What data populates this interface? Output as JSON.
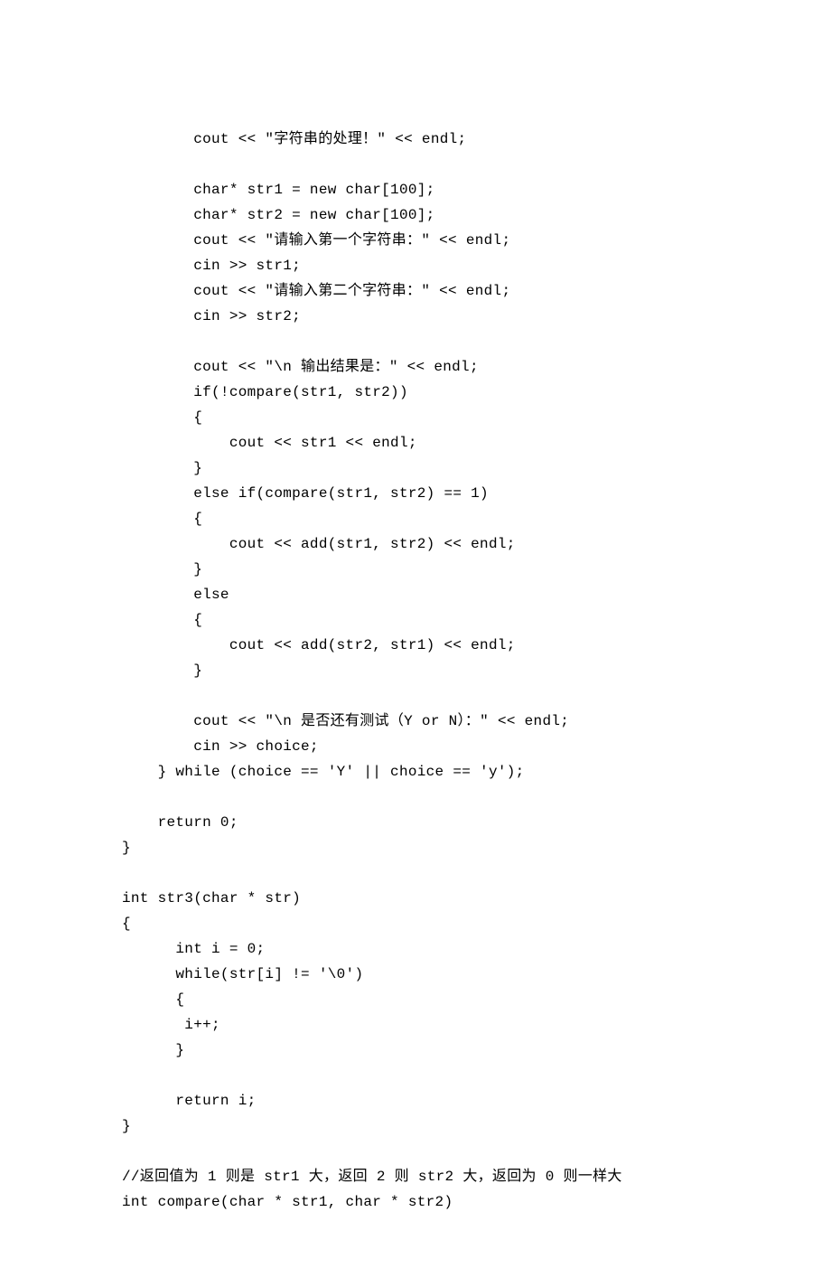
{
  "lines": [
    "        cout << \"字符串的处理！\" << endl;",
    "",
    "        char* str1 = new char[100];",
    "        char* str2 = new char[100];",
    "        cout << \"请输入第一个字符串：\" << endl;",
    "        cin >> str1;",
    "        cout << \"请输入第二个字符串：\" << endl;",
    "        cin >> str2;",
    "",
    "        cout << \"\\n 输出结果是：\" << endl;",
    "        if(!compare(str1, str2))",
    "        {",
    "            cout << str1 << endl;",
    "        }",
    "        else if(compare(str1, str2) == 1)",
    "        {",
    "            cout << add(str1, str2) << endl;",
    "        }",
    "        else",
    "        {",
    "            cout << add(str2, str1) << endl;",
    "        }",
    "",
    "        cout << \"\\n 是否还有测试（Y or N）：\" << endl;",
    "        cin >> choice;",
    "    } while (choice == 'Y' || choice == 'y');",
    "",
    "    return 0;",
    "}",
    "",
    "int str3(char * str)",
    "{",
    "      int i = 0;",
    "      while(str[i] != '\\0')",
    "      {",
    "       i++;",
    "      }",
    "",
    "      return i;",
    "}",
    "",
    "//返回值为 1 则是 str1 大，返回 2 则 str2 大，返回为 0 则一样大",
    "int compare(char * str1, char * str2)"
  ]
}
